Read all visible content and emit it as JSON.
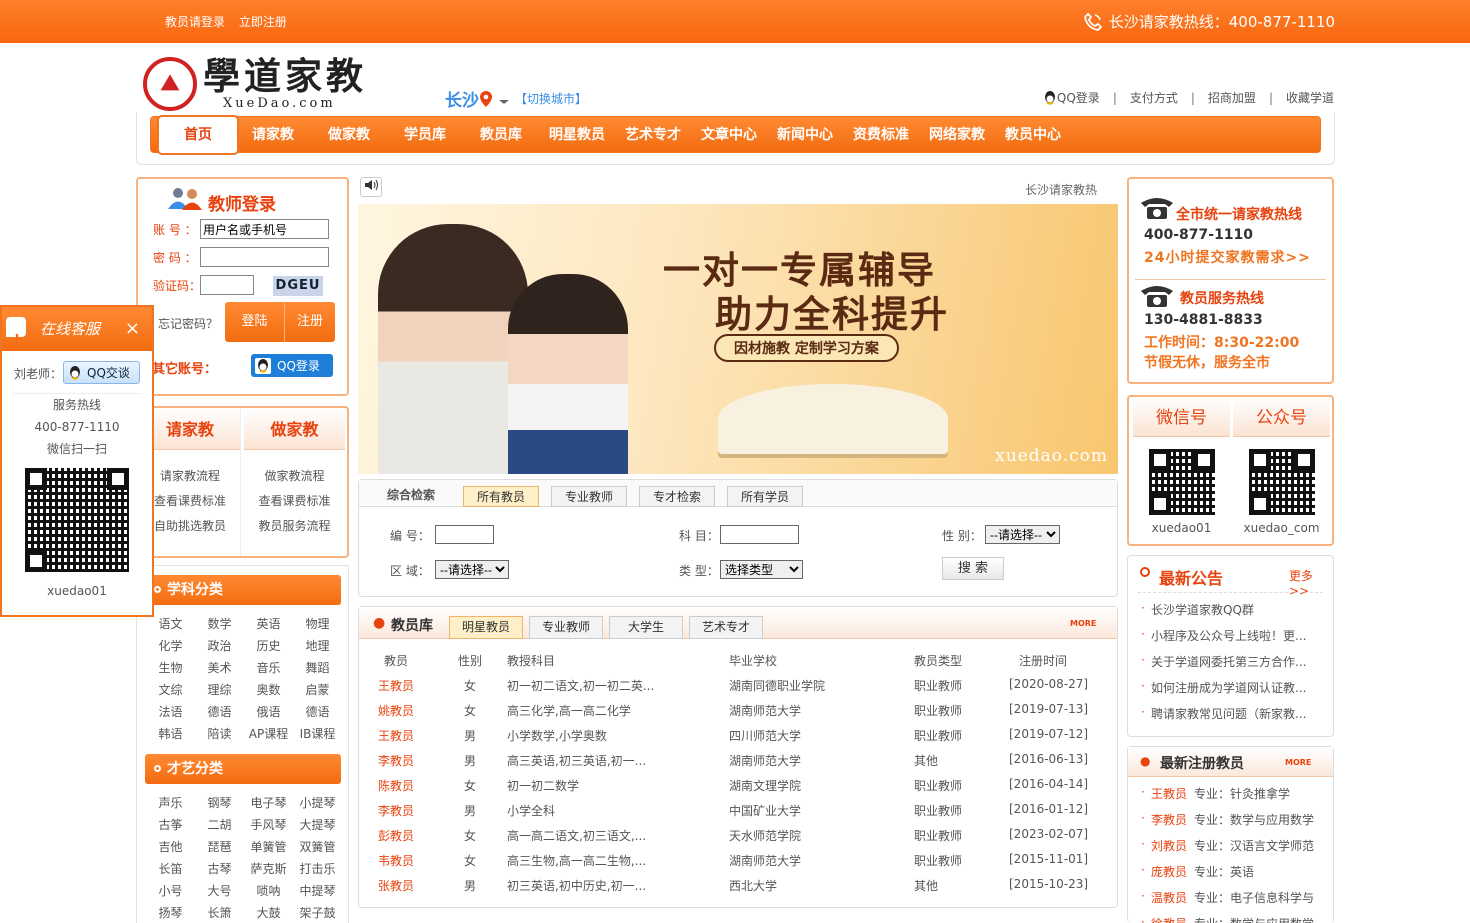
{
  "topbar": {
    "login_link": "教员请登录",
    "register_link": "立即注册",
    "hotline": "长沙请家教热线：400-877-1110"
  },
  "header": {
    "logo_cn": "學道家教",
    "logo_en": "XueDao.com",
    "city": "长沙",
    "switch_city": "【切换城市】",
    "links": [
      "QQ登录",
      "支付方式",
      "招商加盟",
      "收藏学道"
    ]
  },
  "nav": {
    "items": [
      "首页",
      "请家教",
      "做家教",
      "学员库",
      "教员库",
      "明星教员",
      "艺术专才",
      "文章中心",
      "新闻中心",
      "资费标准",
      "网络家教",
      "教员中心"
    ]
  },
  "login": {
    "title": "教师登录",
    "account_label": "账  号 ：",
    "account_placeholder": "用户名或手机号",
    "password_label": "密  码 ：",
    "captcha_label": "验证码：",
    "captcha_code": "DGEU",
    "forgot": "忘记密码？",
    "login_btn": "登陆",
    "register_btn": "注册",
    "other_accounts": "其它账号：",
    "qq_login": "QQ登录"
  },
  "service": {
    "col1_title": "请家教",
    "col1_items": [
      "请家教流程",
      "查看课费标准",
      "自助挑选教员"
    ],
    "col2_title": "做家教",
    "col2_items": [
      "做家教流程",
      "查看课费标准",
      "教员服务流程"
    ]
  },
  "subjects": {
    "title": "学科分类",
    "items": [
      "语文",
      "数学",
      "英语",
      "物理",
      "化学",
      "政治",
      "历史",
      "地理",
      "生物",
      "美术",
      "音乐",
      "舞蹈",
      "文综",
      "理综",
      "奥数",
      "启蒙",
      "法语",
      "德语",
      "俄语",
      "德语",
      "韩语",
      "陪读",
      "AP课程",
      "IB课程"
    ]
  },
  "arts": {
    "title": "才艺分类",
    "items": [
      "声乐",
      "钢琴",
      "电子琴",
      "小提琴",
      "古筝",
      "二胡",
      "手风琴",
      "大提琴",
      "吉他",
      "琵琶",
      "单簧管",
      "双簧管",
      "长笛",
      "古琴",
      "萨克斯",
      "打击乐",
      "小号",
      "大号",
      "唢呐",
      "中提琴",
      "扬琴",
      "长箫",
      "大鼓",
      "架子鼓"
    ]
  },
  "float_kf": {
    "title": "在线客服",
    "close": "×",
    "teacher": "刘老师：",
    "qq_chat": "QQ交谈",
    "hotline_label": "服务热线",
    "hotline": "400-877-1110",
    "wechat_scan": "微信扫一扫",
    "wechat_id": "xuedao01"
  },
  "marquee": "长沙请家教热",
  "banner": {
    "line1": "一对一专属辅导",
    "line2": "助力全科提升",
    "tag": "因材施教  定制学习方案",
    "site": "xuedao.com"
  },
  "search": {
    "tabs": [
      "综合检索",
      "所有教员",
      "专业教师",
      "专才检索",
      "所有学员"
    ],
    "num_label": "编  号：",
    "subject_label": "科  目：",
    "gender_label": "性  别：",
    "gender_value": "--请选择--",
    "area_label": "区  域：",
    "area_value": "--请选择--",
    "type_label": "类  型：",
    "type_value": "选择类型",
    "search_btn": "搜  索"
  },
  "teacher_lib": {
    "title": "教员库",
    "tabs": [
      "明星教员",
      "专业教师",
      "大学生",
      "艺术专才"
    ],
    "more": "MORE",
    "headers": [
      "教员",
      "性别",
      "教授科目",
      "毕业学校",
      "教员类型",
      "注册时间"
    ],
    "rows": [
      [
        "王教员",
        "女",
        "初一初二语文,初一初二英...",
        "湖南同德职业学院",
        "职业教师",
        "[2020-08-27]"
      ],
      [
        "姚教员",
        "女",
        "高三化学,高一高二化学",
        "湖南师范大学",
        "职业教师",
        "[2019-07-13]"
      ],
      [
        "王教员",
        "男",
        "小学数学,小学奥数",
        "四川师范大学",
        "职业教师",
        "[2019-07-12]"
      ],
      [
        "李教员",
        "男",
        "高三英语,初三英语,初一...",
        "湖南师范大学",
        "其他",
        "[2016-06-13]"
      ],
      [
        "陈教员",
        "女",
        "初一初二数学",
        "湖南文理学院",
        "职业教师",
        "[2016-04-14]"
      ],
      [
        "李教员",
        "男",
        "小学全科",
        "中国矿业大学",
        "职业教师",
        "[2016-01-12]"
      ],
      [
        "彭教员",
        "女",
        "高一高二语文,初三语文,...",
        "天水师范学院",
        "职业教师",
        "[2023-02-07]"
      ],
      [
        "韦教员",
        "女",
        "高三生物,高一高二生物,...",
        "湖南师范大学",
        "职业教师",
        "[2015-11-01]"
      ],
      [
        "张教员",
        "男",
        "初三英语,初中历史,初一...",
        "西北大学",
        "其他",
        "[2015-10-23]"
      ]
    ]
  },
  "hotlines": {
    "title1": "全市统一请家教热线",
    "phone1": "400-877-1110",
    "link1": "24小时提交家教需求>>",
    "title2": "教员服务热线",
    "phone2": "130-4881-8833",
    "hours": "工作时间：8:30-22:00",
    "holiday": "节假无休，服务全市"
  },
  "wechat": {
    "col1_title": "微信号",
    "col1_id": "xuedao01",
    "col2_title": "公众号",
    "col2_id": "xuedao_com"
  },
  "notices": {
    "title": "最新公告",
    "more": "更多>>",
    "items": [
      "长沙学道家教QQ群",
      "小程序及公众号上线啦！更...",
      "关于学道网委托第三方合作...",
      "如何注册成为学道网认证教...",
      "聘请家教常见问题（新家教..."
    ]
  },
  "new_teachers": {
    "title": "最新注册教员",
    "more": "MORE",
    "items": [
      {
        "name": "王教员",
        "major": "专业：针灸推拿学"
      },
      {
        "name": "李教员",
        "major": "专业：数学与应用数学"
      },
      {
        "name": "刘教员",
        "major": "专业：汉语言文学师范"
      },
      {
        "name": "庞教员",
        "major": "专业：英语"
      },
      {
        "name": "温教员",
        "major": "专业：电子信息科学与"
      },
      {
        "name": "徐教员",
        "major": "专业：数学与应用数学"
      }
    ]
  },
  "colors": {
    "brand": "#f36c10",
    "accent": "#e8430f",
    "link": "#3a8ee6"
  }
}
